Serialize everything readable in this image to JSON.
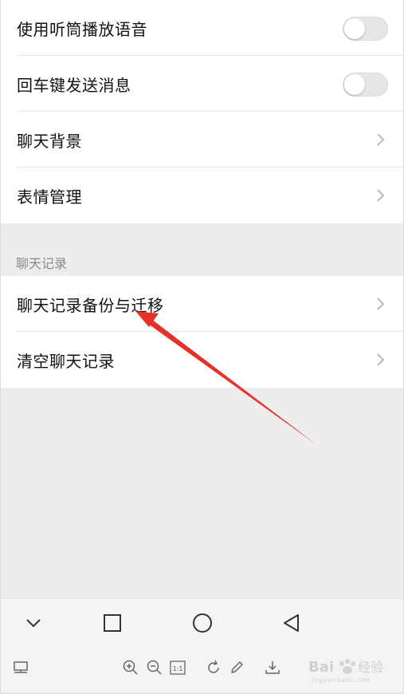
{
  "settings": {
    "rows": [
      {
        "label": "使用听筒播放语音",
        "control": "toggle",
        "on": false
      },
      {
        "label": "回车键发送消息",
        "control": "toggle",
        "on": false
      },
      {
        "label": "聊天背景",
        "control": "chevron"
      },
      {
        "label": "表情管理",
        "control": "chevron"
      }
    ]
  },
  "chat_history": {
    "section_title": "聊天记录",
    "rows": [
      {
        "label": "聊天记录备份与迁移",
        "control": "chevron"
      },
      {
        "label": "清空聊天记录",
        "control": "chevron"
      }
    ]
  },
  "navbar": {
    "icons": [
      "chevron-down-icon",
      "square-icon",
      "circle-icon",
      "back-triangle-icon"
    ]
  },
  "toolbar": {
    "icons": [
      "layout-icon",
      "zoom-in-icon",
      "zoom-out-icon",
      "actual-size-icon",
      "rotate-icon",
      "edit-icon",
      "download-icon"
    ],
    "actual_size_label": "1:1"
  },
  "watermark": {
    "text": "Bai 经验",
    "subtext": "jingyan.baidu.com"
  },
  "colors": {
    "annotation_arrow": "#e8302a",
    "page_background": "#ededed"
  }
}
